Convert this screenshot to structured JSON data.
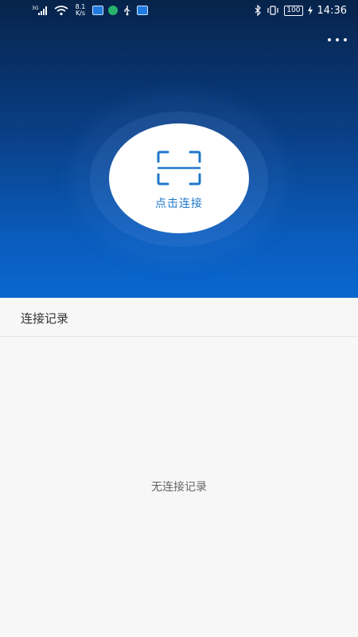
{
  "status_bar": {
    "signal_type": "3G",
    "net_speed_value": "8.1",
    "net_speed_unit": "K/s",
    "battery": "100",
    "time": "14:36",
    "icons": [
      "signal-icon",
      "wifi-icon",
      "app-icon",
      "wechat-icon",
      "usb-icon",
      "message-app-icon",
      "bluetooth-icon",
      "vibrate-icon",
      "battery-icon",
      "charging-icon"
    ]
  },
  "hero": {
    "connect_label": "点击连接",
    "accent_color": "#1f78c9"
  },
  "records": {
    "title": "连接记录",
    "empty_text": "无连接记录"
  },
  "colors": {
    "hero_top": "#06234a",
    "hero_bottom": "#0a67cf",
    "background": "#f7f7f7"
  }
}
